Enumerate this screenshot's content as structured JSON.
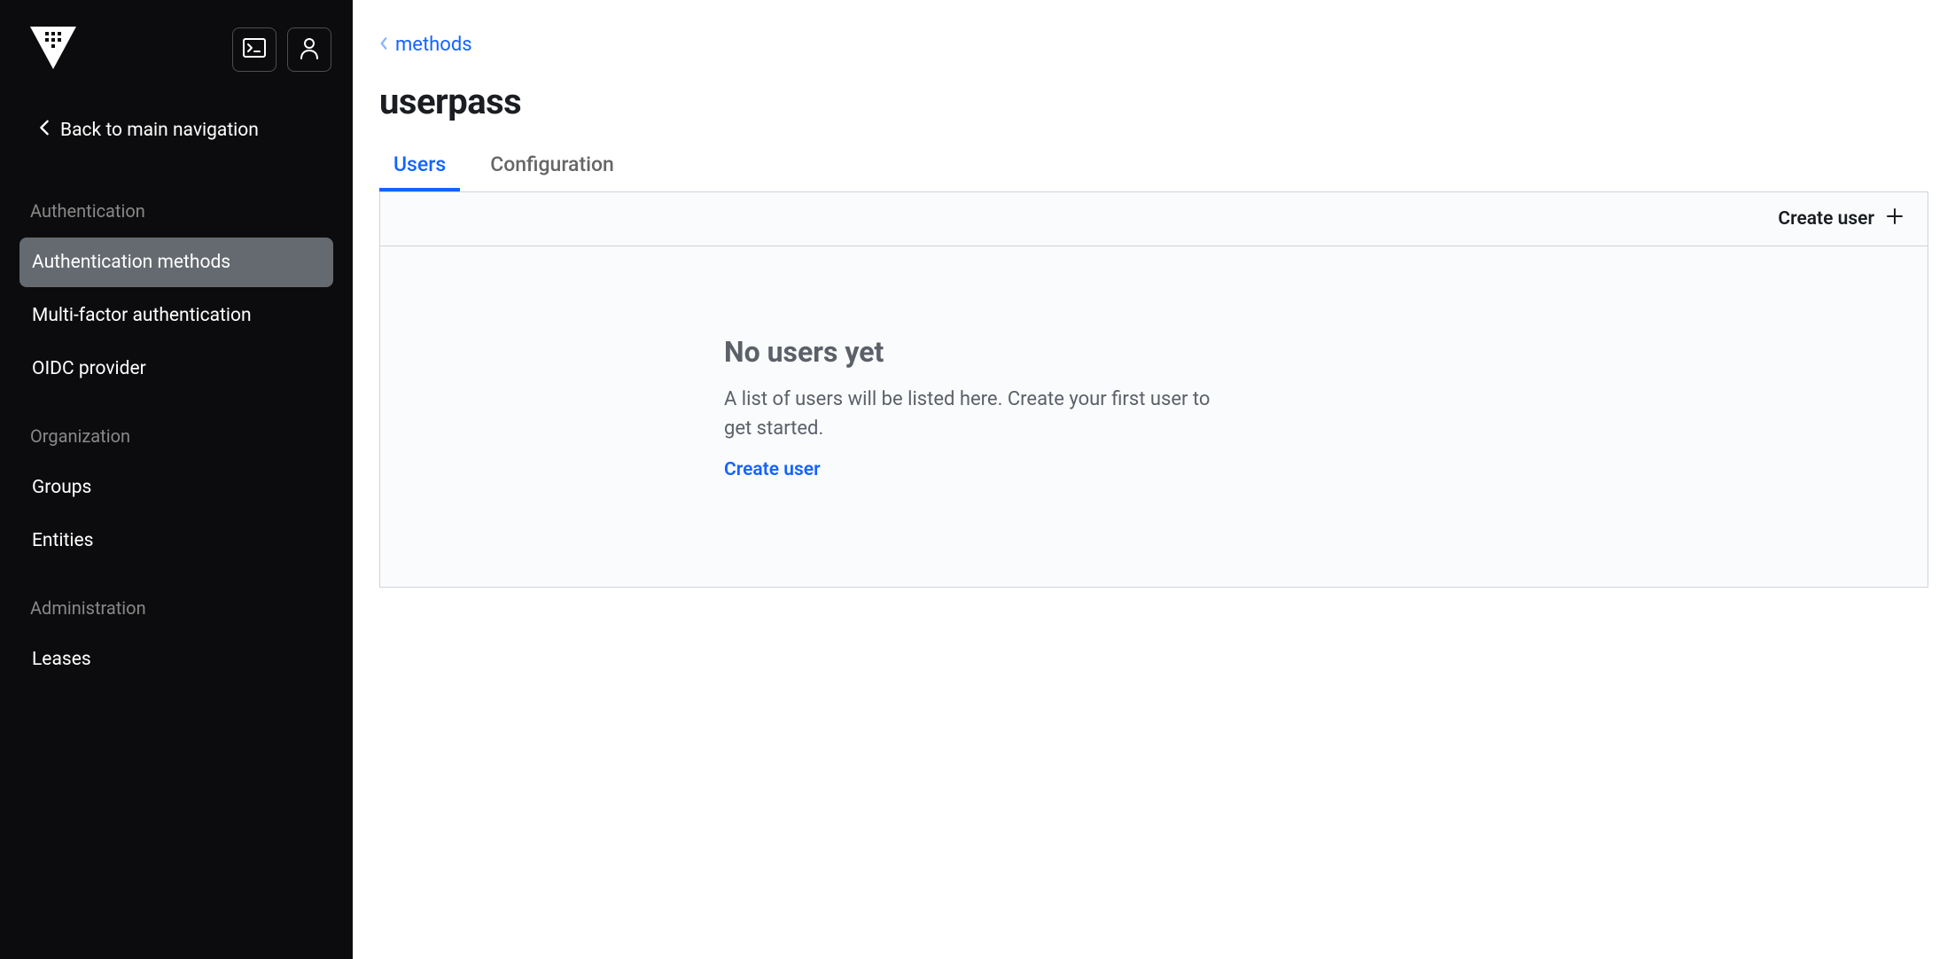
{
  "sidebar": {
    "back_label": "Back to main navigation",
    "sections": [
      {
        "label": "Authentication",
        "items": [
          {
            "label": "Authentication methods",
            "active": true
          },
          {
            "label": "Multi-factor authentication",
            "active": false
          },
          {
            "label": "OIDC provider",
            "active": false
          }
        ]
      },
      {
        "label": "Organization",
        "items": [
          {
            "label": "Groups",
            "active": false
          },
          {
            "label": "Entities",
            "active": false
          }
        ]
      },
      {
        "label": "Administration",
        "items": [
          {
            "label": "Leases",
            "active": false
          }
        ]
      }
    ]
  },
  "breadcrumb": {
    "label": "methods"
  },
  "page": {
    "title": "userpass"
  },
  "tabs": [
    {
      "label": "Users",
      "active": true
    },
    {
      "label": "Configuration",
      "active": false
    }
  ],
  "toolbar": {
    "create_label": "Create user"
  },
  "empty": {
    "title": "No users yet",
    "desc": "A list of users will be listed here. Create your first user to get started.",
    "link": "Create user"
  }
}
